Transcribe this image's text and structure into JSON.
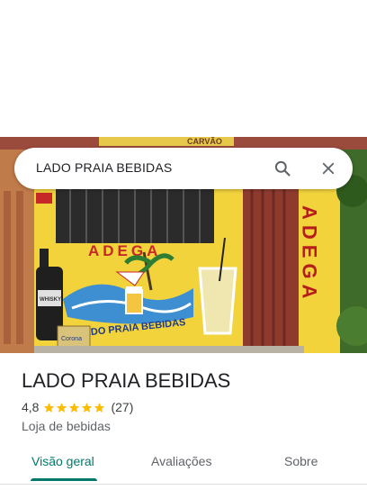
{
  "search": {
    "query": "LADO PRAIA BEBIDAS"
  },
  "photo": {
    "sign_top": "CARVÃO",
    "wall_text": "ADEGA",
    "banner_text": "LADO PRAIA BEBIDAS",
    "bottle_label": "WHISKY",
    "crate_label": "Corona",
    "pillar_text": "ADEGA"
  },
  "place": {
    "name": "LADO PRAIA BEBIDAS",
    "rating": "4,8",
    "rating_value": 4.8,
    "review_count": "(27)",
    "category": "Loja de bebidas"
  },
  "tabs": [
    {
      "label": "Visão geral",
      "active": true
    },
    {
      "label": "Avaliações",
      "active": false
    },
    {
      "label": "Sobre",
      "active": false
    }
  ],
  "colors": {
    "accent": "#00796b",
    "star": "#fbbc04",
    "wall": "#f2d33c"
  },
  "icons": {
    "search": "search-icon",
    "close": "close-icon",
    "star": "star-icon"
  }
}
